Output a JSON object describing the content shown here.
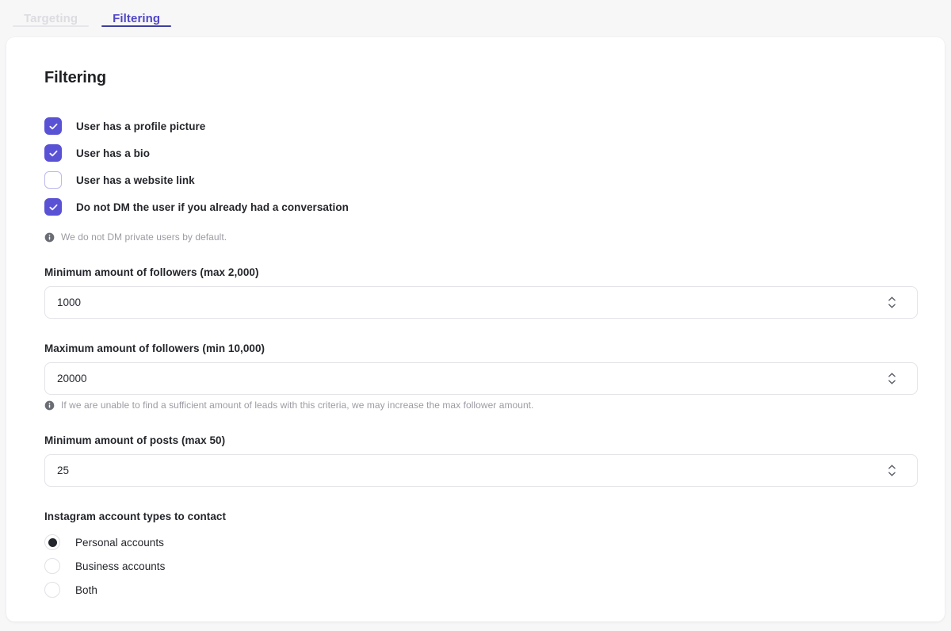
{
  "tabs": [
    {
      "label": "Targeting",
      "active": false
    },
    {
      "label": "Filtering",
      "active": true
    }
  ],
  "page": {
    "title": "Filtering"
  },
  "checkboxes": [
    {
      "label": "User has a profile picture",
      "checked": true
    },
    {
      "label": "User has a bio",
      "checked": true
    },
    {
      "label": "User has a website link",
      "checked": false
    },
    {
      "label": "Do not DM the user if you already had a conversation",
      "checked": true
    }
  ],
  "hints": {
    "private_users": "We do not DM private users by default.",
    "max_followers": "If we are unable to find a sufficient amount of leads with this criteria, we may increase the max follower amount."
  },
  "fields": {
    "min_followers": {
      "label": "Minimum amount of followers (max 2,000)",
      "value": "1000",
      "placeholder": "1000"
    },
    "max_followers": {
      "label": "Maximum amount of followers (min 10,000)",
      "value": "20000",
      "placeholder": "20000"
    },
    "min_posts": {
      "label": "Minimum amount of posts (max 50)",
      "value": "25",
      "placeholder": "25"
    }
  },
  "account_types": {
    "label": "Instagram account types to contact",
    "options": [
      {
        "label": "Personal accounts",
        "selected": true
      },
      {
        "label": "Business accounts",
        "selected": false
      },
      {
        "label": "Both",
        "selected": false
      }
    ]
  },
  "colors": {
    "accent": "#5a52d5",
    "tab_active": "#4f46c8",
    "tab_underline_active": "#3b3fa0",
    "tab_inactive": "#dcdce1",
    "radio_selected": "#23262d",
    "page_background": "#f7f7f8",
    "card_background": "#ffffff",
    "hint_text": "#9b9ba3"
  },
  "icons": {
    "checkmark": "check-icon",
    "info": "info-icon",
    "spinner_up": "chevron-up-icon",
    "spinner_down": "chevron-down-icon"
  }
}
